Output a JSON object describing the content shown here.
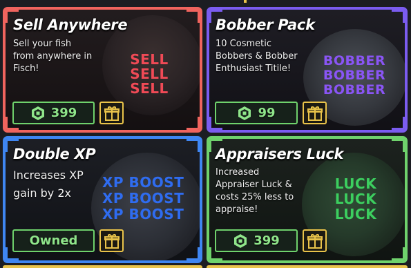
{
  "colors": {
    "sell_border": "#f0645e",
    "bobber_border": "#7b5cf0",
    "xp_border": "#3f86f2",
    "luck_border": "#6fd26c",
    "price_green": "#8fe58a",
    "gift_gold": "#e9c34a",
    "sell_art_text": "#f04a56",
    "bobber_art_text": "#8a55f5",
    "xp_art_text": "#2f6cf0",
    "luck_art_text": "#3ccf5f"
  },
  "cards": {
    "sell": {
      "title": "Sell Anywhere",
      "desc": "Sell your fish from anywhere in Fisch!",
      "art_words": [
        "SELL",
        "SELL",
        "SELL"
      ],
      "price": "399",
      "currency_icon": "robux-icon",
      "gift_icon": "gift-icon"
    },
    "bobber": {
      "title": "Bobber Pack",
      "desc": "10 Cosmetic Bobbers & Bobber Enthusiast Titile!",
      "art_words": [
        "BOBBER",
        "BOBBER",
        "BOBBER"
      ],
      "price": "99",
      "currency_icon": "robux-icon",
      "gift_icon": "gift-icon"
    },
    "xp": {
      "title": "Double XP",
      "desc": "Increases XP gain by 2x",
      "art_words": [
        "XP BOOST",
        "XP BOOST",
        "XP BOOST"
      ],
      "status": "Owned",
      "gift_icon": "gift-icon"
    },
    "luck": {
      "title": "Appraisers Luck",
      "desc": "Increased Appraiser Luck & costs 25% less to appraise!",
      "art_words": [
        "LUCK",
        "LUCK",
        "LUCK"
      ],
      "price": "399",
      "currency_icon": "robux-icon",
      "gift_icon": "gift-icon"
    }
  }
}
